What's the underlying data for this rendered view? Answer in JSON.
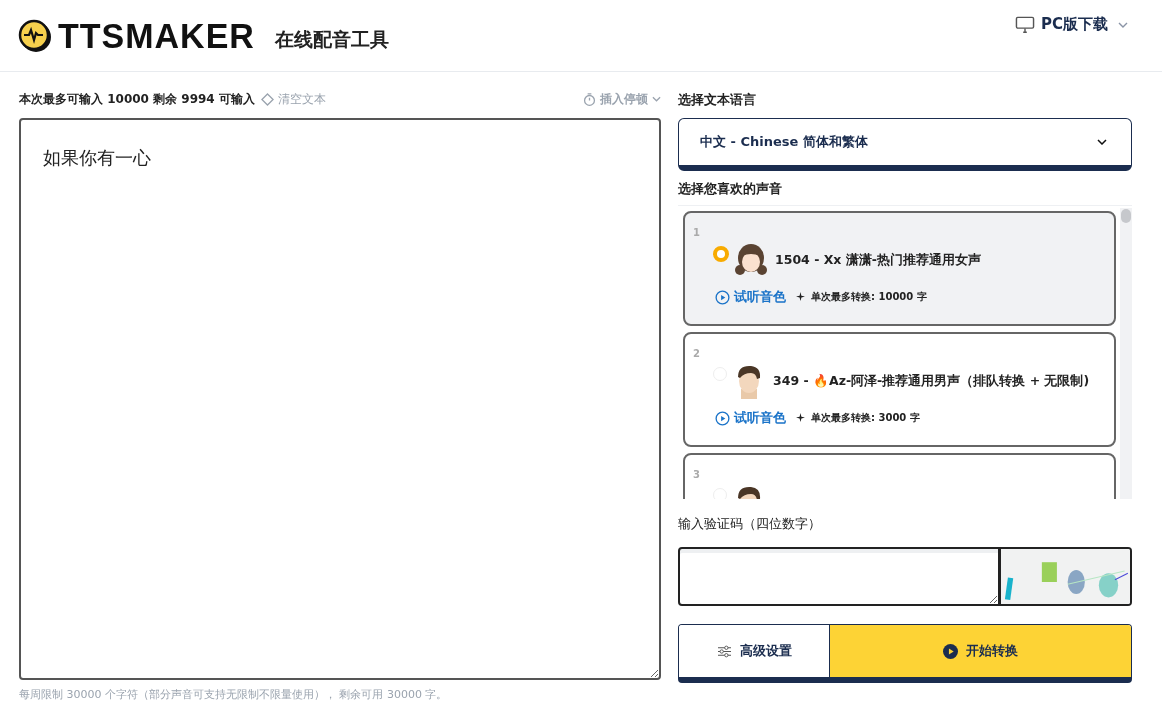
{
  "header": {
    "logo_text": "TTSMAKER",
    "tagline": "在线配音工具",
    "download": "PC版下载"
  },
  "editor": {
    "limit_text": "本次最多可输入 10000 剩余 9994 可输入",
    "clear": "清空文本",
    "insert_pause": "插入停顿",
    "value": "如果你有一心",
    "footer_note": "每周限制 30000 个字符（部分声音可支持无限制不限量使用）， 剩余可用 30000 字。"
  },
  "language": {
    "label": "选择文本语言",
    "value": "中文 - Chinese 简体和繁体"
  },
  "voices": {
    "label": "选择您喜欢的声音",
    "items": [
      {
        "number": "1",
        "name": "1504 - Xx 潇潇-热门推荐通用女声",
        "preview": "试听音色",
        "limit": "单次最多转换: 10000 字",
        "selected": true,
        "kind": "female"
      },
      {
        "number": "2",
        "name": "349 - 🔥Az-阿泽-推荐通用男声（排队转换 + 无限制)",
        "preview": "试听音色",
        "limit": "单次最多转换: 3000 字",
        "selected": false,
        "kind": "male"
      },
      {
        "number": "3",
        "selected": false,
        "kind": "male"
      }
    ]
  },
  "captcha": {
    "label": "输入验证码（四位数字）"
  },
  "buttons": {
    "advanced": "高级设置",
    "start": "开始转换"
  }
}
